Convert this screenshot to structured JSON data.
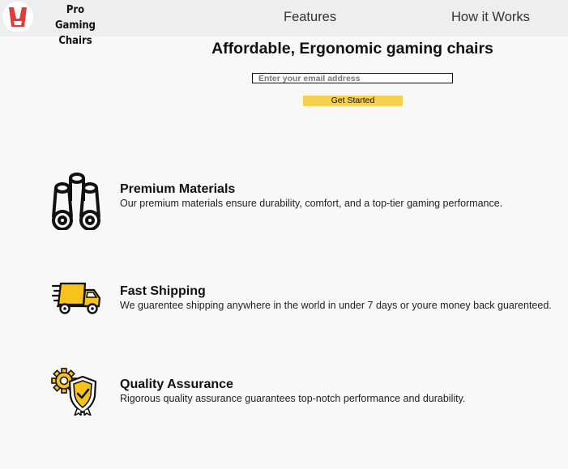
{
  "header": {
    "brand_line1": "Pro Gaming",
    "brand_line2": "Chairs",
    "nav": {
      "features": "Features",
      "how_it_works": "How it Works"
    }
  },
  "hero": {
    "title": "Affordable, Ergonomic gaming chairs",
    "email_placeholder": "Enter your email address",
    "email_value": "",
    "cta_label": "Get Started"
  },
  "features": [
    {
      "icon": "pipes-icon",
      "title": "Premium Materials",
      "description": "Our premium materials ensure durability, comfort, and a top-tier gaming performance."
    },
    {
      "icon": "delivery-truck-icon",
      "title": "Fast Shipping",
      "description": "We guarentee shipping anywhere in the world in under 7 days or youre money back guarenteed."
    },
    {
      "icon": "quality-shield-icon",
      "title": "Quality Assurance",
      "description": "Rigorous quality assurance guarantees top-notch performance and durability."
    }
  ],
  "colors": {
    "page_background": "#f8f8f8",
    "header_background": "#eeeeee",
    "accent_yellow": "#f5d04e",
    "logo_red": "#e23b3b",
    "text_dark": "#111111"
  }
}
